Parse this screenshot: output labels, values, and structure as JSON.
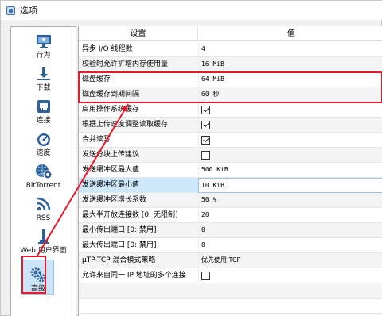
{
  "window": {
    "title": "选项"
  },
  "sidebar": {
    "items": [
      {
        "label": "行为",
        "icon": "monitor-icon"
      },
      {
        "label": "下载",
        "icon": "download-icon"
      },
      {
        "label": "连接",
        "icon": "network-icon"
      },
      {
        "label": "速度",
        "icon": "speedometer-icon"
      },
      {
        "label": "BitTorrent",
        "icon": "globe-gear-icon"
      },
      {
        "label": "RSS",
        "icon": "rss-icon"
      },
      {
        "label": "Web 用户界面",
        "icon": "webui-icon"
      },
      {
        "label": "高级",
        "icon": "gears-icon",
        "selected": true
      }
    ]
  },
  "table": {
    "headers": {
      "settings": "设置",
      "value": "值"
    },
    "rows": [
      {
        "setting": "异步 I/O 线程数",
        "value": "4"
      },
      {
        "setting": "校验时允许扩增内存使用量",
        "value": "16 MiB"
      },
      {
        "setting": "磁盘缓存",
        "value": "64 MiB"
      },
      {
        "setting": "磁盘缓存到期间隔",
        "value": "60 秒"
      },
      {
        "setting": "启用操作系统缓存",
        "checkbox": true,
        "checked": true
      },
      {
        "setting": "根据上传速度调整读取缓存",
        "checkbox": true,
        "checked": true
      },
      {
        "setting": "合并读写",
        "checkbox": true,
        "checked": true
      },
      {
        "setting": "发送分块上传建议",
        "checkbox": true,
        "checked": false
      },
      {
        "setting": "发送缓冲区最大值",
        "value": "500 KiB"
      },
      {
        "setting": "发送缓冲区最小值",
        "value": "10 KiB"
      },
      {
        "setting": "发送缓冲区增长系数",
        "value": "50 %"
      },
      {
        "setting": "最大半开放连接数 [0: 无限制]",
        "value": "20"
      },
      {
        "setting": "最小传出端口 [0: 禁用]",
        "value": "0"
      },
      {
        "setting": "最大传出端口 [0: 禁用]",
        "value": "0"
      },
      {
        "setting": "μTP-TCP 混合模式策略",
        "value": "优先使用 TCP"
      },
      {
        "setting": "允许来自同一 IP 地址的多个连接",
        "checkbox": true,
        "checked": false
      }
    ]
  },
  "colors": {
    "annotation": "#e8192c",
    "selection": "#cce4f7"
  }
}
